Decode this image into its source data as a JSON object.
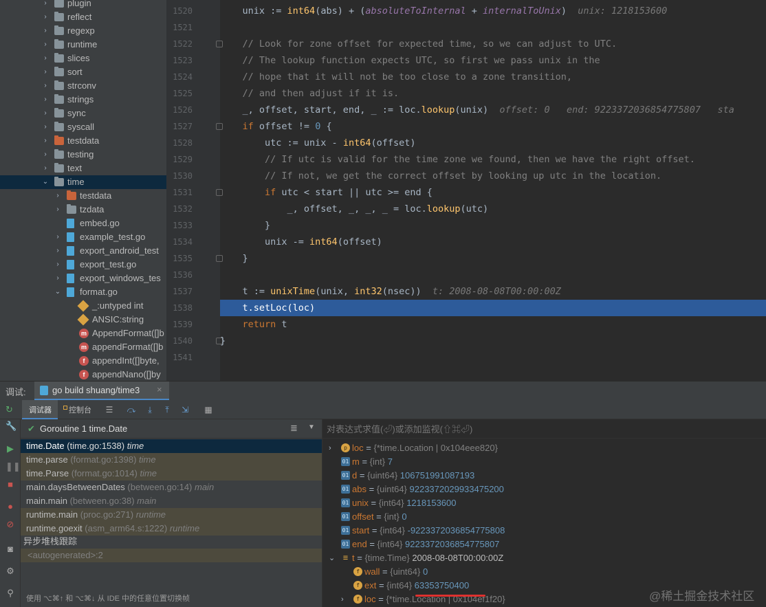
{
  "tree": {
    "items": [
      {
        "label": "plugin",
        "type": "folder",
        "depth": 0,
        "chev": "›"
      },
      {
        "label": "reflect",
        "type": "folder",
        "depth": 0,
        "chev": "›"
      },
      {
        "label": "regexp",
        "type": "folder",
        "depth": 0,
        "chev": "›"
      },
      {
        "label": "runtime",
        "type": "folder",
        "depth": 0,
        "chev": "›"
      },
      {
        "label": "slices",
        "type": "folder",
        "depth": 0,
        "chev": "›"
      },
      {
        "label": "sort",
        "type": "folder",
        "depth": 0,
        "chev": "›"
      },
      {
        "label": "strconv",
        "type": "folder",
        "depth": 0,
        "chev": "›"
      },
      {
        "label": "strings",
        "type": "folder",
        "depth": 0,
        "chev": "›"
      },
      {
        "label": "sync",
        "type": "folder",
        "depth": 0,
        "chev": "›"
      },
      {
        "label": "syscall",
        "type": "folder",
        "depth": 0,
        "chev": "›"
      },
      {
        "label": "testdata",
        "type": "folder-orange",
        "depth": 0,
        "chev": "›"
      },
      {
        "label": "testing",
        "type": "folder",
        "depth": 0,
        "chev": "›"
      },
      {
        "label": "text",
        "type": "folder",
        "depth": 0,
        "chev": "›"
      },
      {
        "label": "time",
        "type": "folder",
        "depth": 0,
        "chev": "⌄",
        "selected": true
      },
      {
        "label": "testdata",
        "type": "folder-orange",
        "depth": 1,
        "chev": "›"
      },
      {
        "label": "tzdata",
        "type": "folder",
        "depth": 1,
        "chev": "›"
      },
      {
        "label": "embed.go",
        "type": "gofile",
        "depth": 1,
        "chev": ""
      },
      {
        "label": "example_test.go",
        "type": "gofile",
        "depth": 1,
        "chev": "›"
      },
      {
        "label": "export_android_test",
        "type": "gofile",
        "depth": 1,
        "chev": "›"
      },
      {
        "label": "export_test.go",
        "type": "gofile",
        "depth": 1,
        "chev": "›"
      },
      {
        "label": "export_windows_tes",
        "type": "gofile",
        "depth": 1,
        "chev": "›"
      },
      {
        "label": "format.go",
        "type": "gofile",
        "depth": 1,
        "chev": "⌄"
      },
      {
        "label": "_:untyped int",
        "type": "diamond",
        "depth": 2,
        "chev": ""
      },
      {
        "label": "ANSIC:string",
        "type": "diamond",
        "depth": 2,
        "chev": ""
      },
      {
        "label": "AppendFormat([]b",
        "type": "m",
        "depth": 2,
        "chev": ""
      },
      {
        "label": "appendFormat([]b",
        "type": "m",
        "depth": 2,
        "chev": ""
      },
      {
        "label": "appendInt([]byte,",
        "type": "f",
        "depth": 2,
        "chev": ""
      },
      {
        "label": "appendNano([]by",
        "type": "f",
        "depth": 2,
        "chev": ""
      }
    ]
  },
  "editor": {
    "line_numbers": [
      "1520",
      "1521",
      "1522",
      "1523",
      "1524",
      "1525",
      "1526",
      "1527",
      "1528",
      "1529",
      "1530",
      "1531",
      "1532",
      "1533",
      "1534",
      "1535",
      "1536",
      "1537",
      "1538",
      "1539",
      "1540",
      "1541"
    ],
    "hints": {
      "l1520": "unix: 1218153600",
      "l1526_offset": "offset: 0",
      "l1526_end": "end: 9223372036854775807",
      "l1526_sta": "sta",
      "l1537": "t: 2008-08-08T00:00:00Z"
    },
    "comments": {
      "c1522": "// Look for zone offset for expected time, so we can adjust to UTC.",
      "c1523": "// The lookup function expects UTC, so first we pass unix in the",
      "c1524": "// hope that it will not be too close to a zone transition,",
      "c1525": "// and then adjust if it is.",
      "c1529": "// If utc is valid for the time zone we found, then we have the right offset.",
      "c1530": "// If not, we get the correct offset by looking up utc in the location."
    }
  },
  "debug": {
    "label": "调试:",
    "session_tab": "go build shuang/time3",
    "close_glyph": "×",
    "tab_debugger": "调试器",
    "tab_console": "控制台",
    "goroutine": "Goroutine 1 time.Date",
    "eval_placeholder": "对表达式求值(⏎)或添加监视(⇧⌘⏎)",
    "async_label": "异步堆栈跟踪",
    "status_hint": "使用 ⌥⌘↑ 和 ⌥⌘↓ 从 IDE 中的任意位置切换帧",
    "frames": [
      {
        "fn": "time.Date",
        "loc": "(time.go:1538)",
        "pkg": "time",
        "style": "sel"
      },
      {
        "fn": "time.parse",
        "loc": "(format.go:1398)",
        "pkg": "time",
        "style": "lib"
      },
      {
        "fn": "time.Parse",
        "loc": "(format.go:1014)",
        "pkg": "time",
        "style": "lib"
      },
      {
        "fn": "main.daysBetweenDates",
        "loc": "(between.go:14)",
        "pkg": "main",
        "style": ""
      },
      {
        "fn": "main.main",
        "loc": "(between.go:38)",
        "pkg": "main",
        "style": ""
      },
      {
        "fn": "runtime.main",
        "loc": "(proc.go:271)",
        "pkg": "runtime",
        "style": "lib"
      },
      {
        "fn": "runtime.goexit",
        "loc": "(asm_arm64.s:1222)",
        "pkg": "runtime",
        "style": "lib"
      }
    ],
    "autogen": "<autogenerated>:2",
    "variables": [
      {
        "chev": "›",
        "ico": "p",
        "icotext": "p",
        "name": "loc",
        "type": "{*time.Location | 0x104eee820}",
        "value": "",
        "vclass": "vs",
        "depth": 0
      },
      {
        "chev": "",
        "ico": "v",
        "icotext": "01",
        "name": "m",
        "type": "{int}",
        "value": "7",
        "vclass": "vn",
        "depth": 0
      },
      {
        "chev": "",
        "ico": "v",
        "icotext": "01",
        "name": "d",
        "type": "{uint64}",
        "value": "106751991087193",
        "vclass": "vn",
        "depth": 0
      },
      {
        "chev": "",
        "ico": "v",
        "icotext": "01",
        "name": "abs",
        "type": "{uint64}",
        "value": "9223372029933475200",
        "vclass": "vn",
        "depth": 0
      },
      {
        "chev": "",
        "ico": "v",
        "icotext": "01",
        "name": "unix",
        "type": "{int64}",
        "value": "1218153600",
        "vclass": "vn",
        "depth": 0
      },
      {
        "chev": "",
        "ico": "v",
        "icotext": "01",
        "name": "offset",
        "type": "{int}",
        "value": "0",
        "vclass": "vn",
        "depth": 0
      },
      {
        "chev": "",
        "ico": "v",
        "icotext": "01",
        "name": "start",
        "type": "{int64}",
        "value": "-9223372036854775808",
        "vclass": "vn",
        "depth": 0
      },
      {
        "chev": "",
        "ico": "v",
        "icotext": "01",
        "name": "end",
        "type": "{int64}",
        "value": "9223372036854775807",
        "vclass": "vn",
        "depth": 0
      },
      {
        "chev": "⌄",
        "ico": "t",
        "icotext": "≡",
        "name": "t",
        "type": "{time.Time}",
        "value": "2008-08-08T00:00:00Z",
        "vclass": "vs",
        "depth": 0
      },
      {
        "chev": "",
        "ico": "f",
        "icotext": "f",
        "name": "wall",
        "type": "{uint64}",
        "value": "0",
        "vclass": "vn",
        "depth": 1
      },
      {
        "chev": "",
        "ico": "f",
        "icotext": "f",
        "name": "ext",
        "type": "{int64}",
        "value": "63353750400",
        "vclass": "vn",
        "depth": 1
      },
      {
        "chev": "›",
        "ico": "f",
        "icotext": "f",
        "name": "loc",
        "type": "{*time.Location | 0x104ef1f20}",
        "value": "",
        "vclass": "vs",
        "depth": 1
      }
    ]
  },
  "watermark": "@稀土掘金技术社区",
  "colors": {
    "accent": "#2d5b9a",
    "keyword": "#cc7832",
    "function": "#ffc66d",
    "number": "#6897bb",
    "underline": "#e0312f"
  }
}
